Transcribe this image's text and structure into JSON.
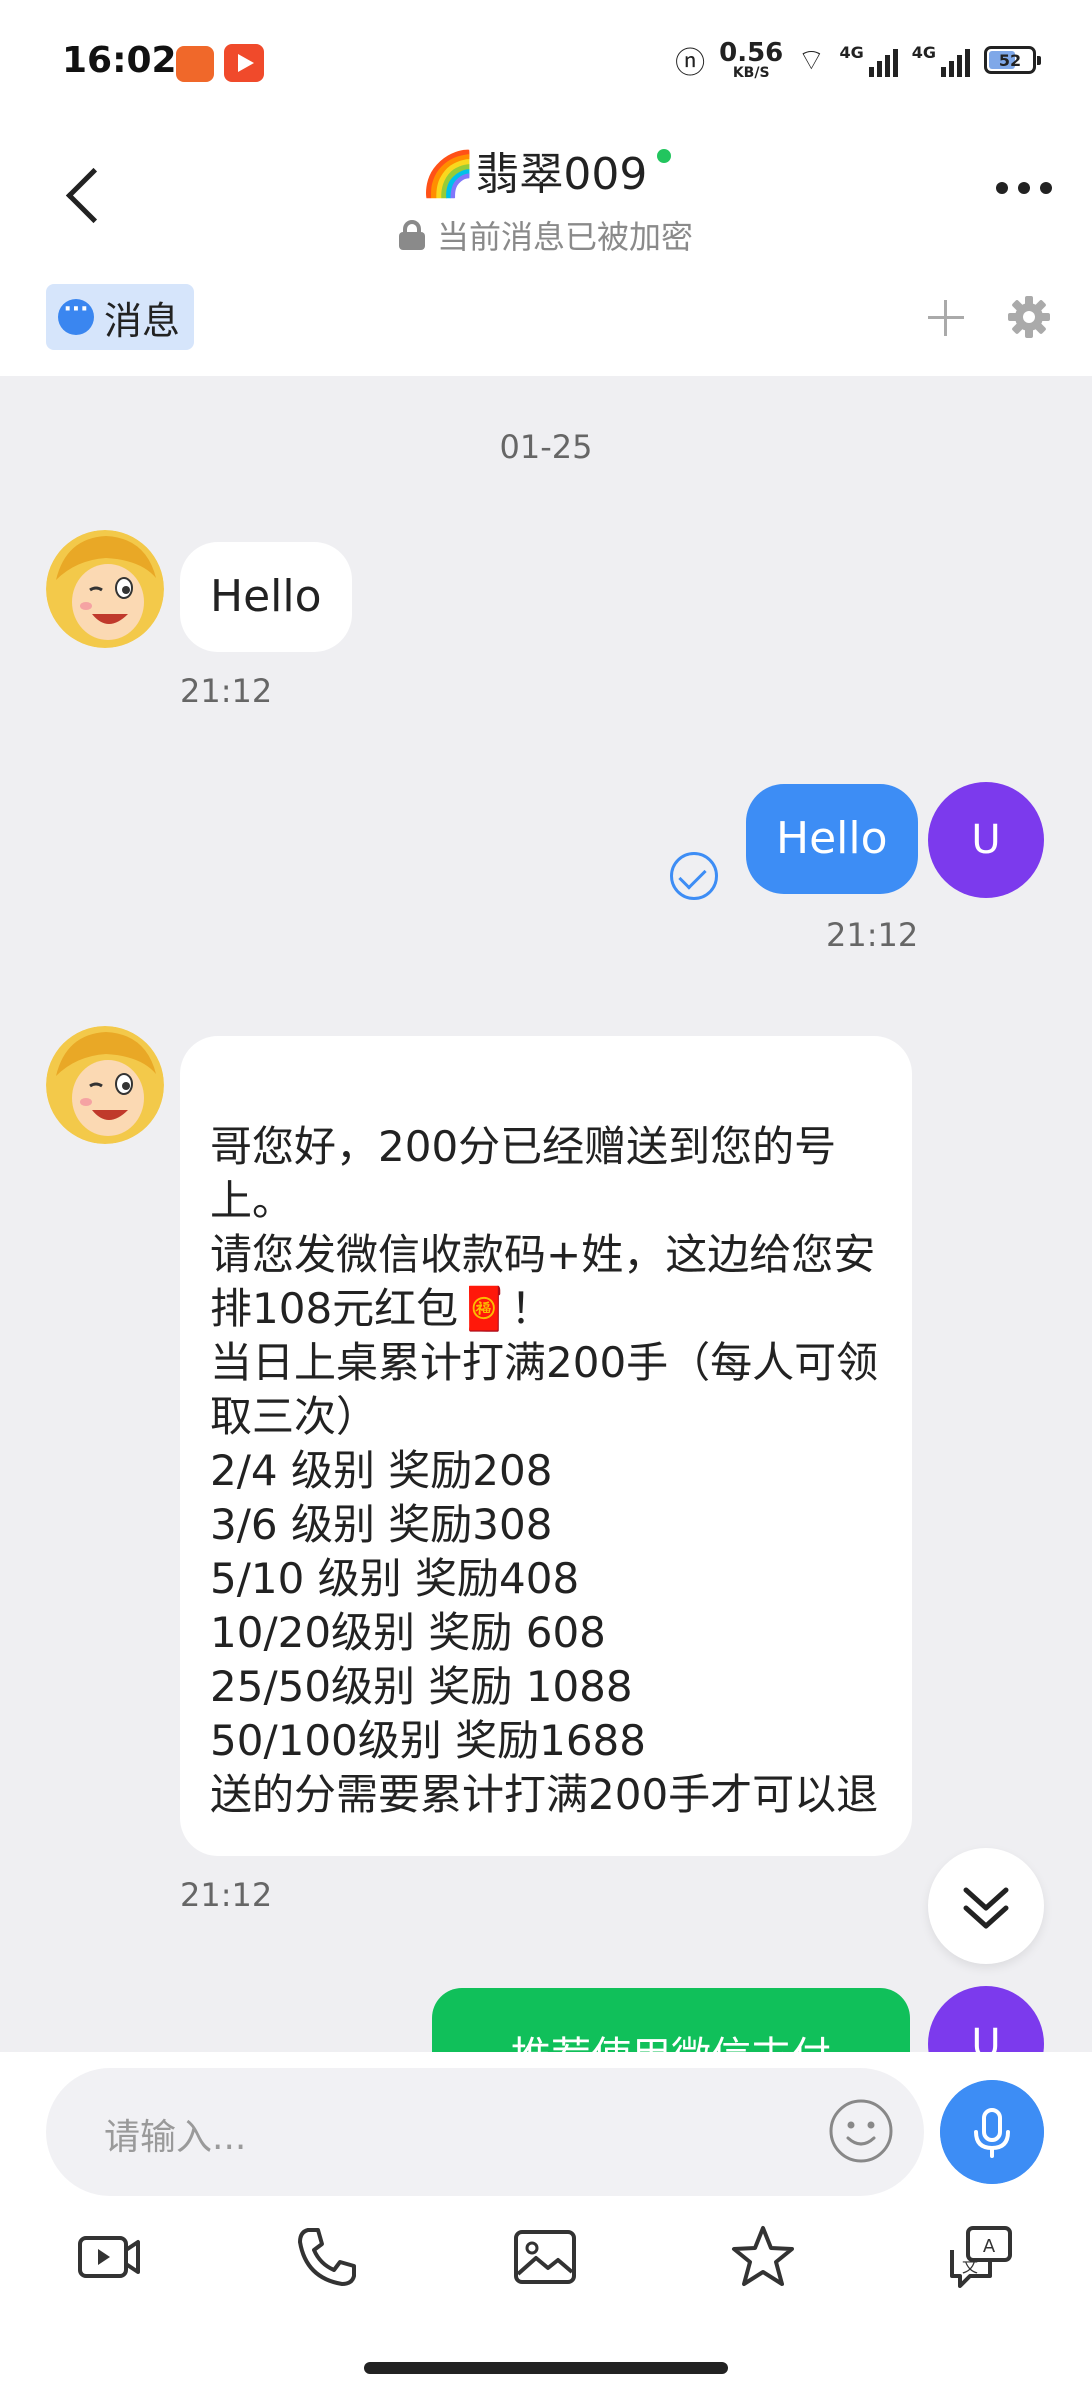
{
  "status_bar": {
    "time": "16:02",
    "net_speed_value": "0.56",
    "net_speed_unit": "KB/S",
    "signal1_label": "4G",
    "signal2_label": "4G",
    "battery_level": "52"
  },
  "header": {
    "title": "🌈翡翠009",
    "subtitle": "当前消息已被加密",
    "online": true
  },
  "tabs": {
    "messages_label": "消息"
  },
  "chat": {
    "date_separator": "01-25",
    "messages": [
      {
        "direction": "in",
        "text": "Hello",
        "time": "21:12"
      },
      {
        "direction": "out",
        "text": "Hello",
        "time": "21:12",
        "sender_initial": "U",
        "read": true
      },
      {
        "direction": "in",
        "text": "哥您好，200分已经赠送到您的号上。\n请您发微信收款码+姓，这边给您安排108元红包🧧！\n当日上桌累计打满200手（每人可领取三次）\n2/4   级别 奖励208\n3/6   级别 奖励308\n5/10 级别 奖励408\n10/20级别 奖励 608\n25/50级别 奖励 1088\n50/100级别 奖励1688\n送的分需要累计打满200手才可以退",
        "time": "21:12"
      },
      {
        "direction": "out",
        "text": "推荐使用微信支付",
        "sender_initial": "U",
        "partially_visible": true
      }
    ]
  },
  "composer": {
    "placeholder": "请输入..."
  },
  "toolbar": {
    "icons": [
      "video-icon",
      "phone-icon",
      "image-icon",
      "star-icon",
      "translate-chat-icon"
    ]
  },
  "colors": {
    "accent": "#3d8df5",
    "avatar_u": "#7c3aed",
    "wechat_green": "#10c05a",
    "chat_bg": "#efeff2"
  }
}
